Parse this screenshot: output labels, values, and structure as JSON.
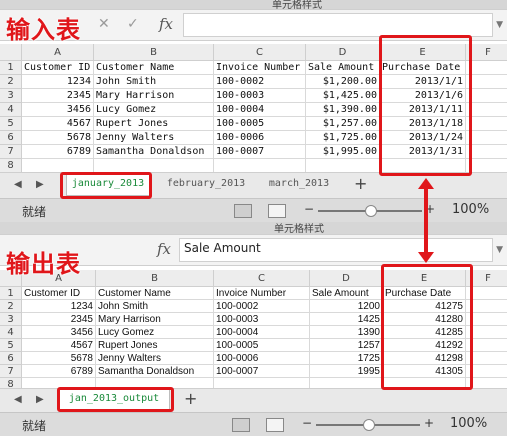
{
  "colors": {
    "annotation_red": "#e0161a",
    "active_tab_text": "#1a8a3a"
  },
  "annotations": {
    "input_label": "输入表",
    "output_label": "输出表"
  },
  "top": {
    "ribbon_item": "单元格样式",
    "formula": {
      "cancel_icon": "close-icon",
      "confirm_icon": "check-icon",
      "fx": "fx",
      "value": ""
    },
    "columns": [
      "A",
      "B",
      "C",
      "D",
      "E",
      "F"
    ],
    "rows": [
      "1",
      "2",
      "3",
      "4",
      "5",
      "6",
      "7",
      "8"
    ],
    "headers": [
      "Customer ID",
      "Customer Name",
      "Invoice Number",
      "Sale Amount",
      "Purchase Date"
    ],
    "data": [
      [
        "1234",
        "John Smith",
        "100-0002",
        "$1,200.00",
        "2013/1/1"
      ],
      [
        "2345",
        "Mary Harrison",
        "100-0003",
        "$1,425.00",
        "2013/1/6"
      ],
      [
        "3456",
        "Lucy Gomez",
        "100-0004",
        "$1,390.00",
        "2013/1/11"
      ],
      [
        "4567",
        "Rupert Jones",
        "100-0005",
        "$1,257.00",
        "2013/1/18"
      ],
      [
        "5678",
        "Jenny Walters",
        "100-0006",
        "$1,725.00",
        "2013/1/24"
      ],
      [
        "6789",
        "Samantha Donaldson",
        "100-0007",
        "$1,995.00",
        "2013/1/31"
      ]
    ],
    "tabs": [
      "january_2013",
      "february_2013",
      "march_2013"
    ],
    "add_tab": "+",
    "status_label": "就绪",
    "zoom_minus": "−",
    "zoom_plus": "+",
    "zoom": "100%",
    "zoom_level_percent": 100
  },
  "bottom": {
    "ribbon_item": "单元格样式",
    "formula": {
      "fx": "fx",
      "value": "Sale Amount"
    },
    "columns": [
      "A",
      "B",
      "C",
      "D",
      "E",
      "F"
    ],
    "rows": [
      "1",
      "2",
      "3",
      "4",
      "5",
      "6",
      "7",
      "8"
    ],
    "headers": [
      "Customer ID",
      "Customer Name",
      "Invoice Number",
      "Sale Amount",
      "Purchase Date"
    ],
    "data": [
      [
        "1234",
        "John Smith",
        "100-0002",
        "1200",
        "41275"
      ],
      [
        "2345",
        "Mary Harrison",
        "100-0003",
        "1425",
        "41280"
      ],
      [
        "3456",
        "Lucy Gomez",
        "100-0004",
        "1390",
        "41285"
      ],
      [
        "4567",
        "Rupert Jones",
        "100-0005",
        "1257",
        "41292"
      ],
      [
        "5678",
        "Jenny Walters",
        "100-0006",
        "1725",
        "41298"
      ],
      [
        "6789",
        "Samantha Donaldson",
        "100-0007",
        "1995",
        "41305"
      ]
    ],
    "tabs": [
      "jan_2013_output"
    ],
    "add_tab": "+",
    "status_label": "就绪",
    "zoom_minus": "−",
    "zoom_plus": "+",
    "zoom": "100%",
    "zoom_level_percent": 100
  }
}
